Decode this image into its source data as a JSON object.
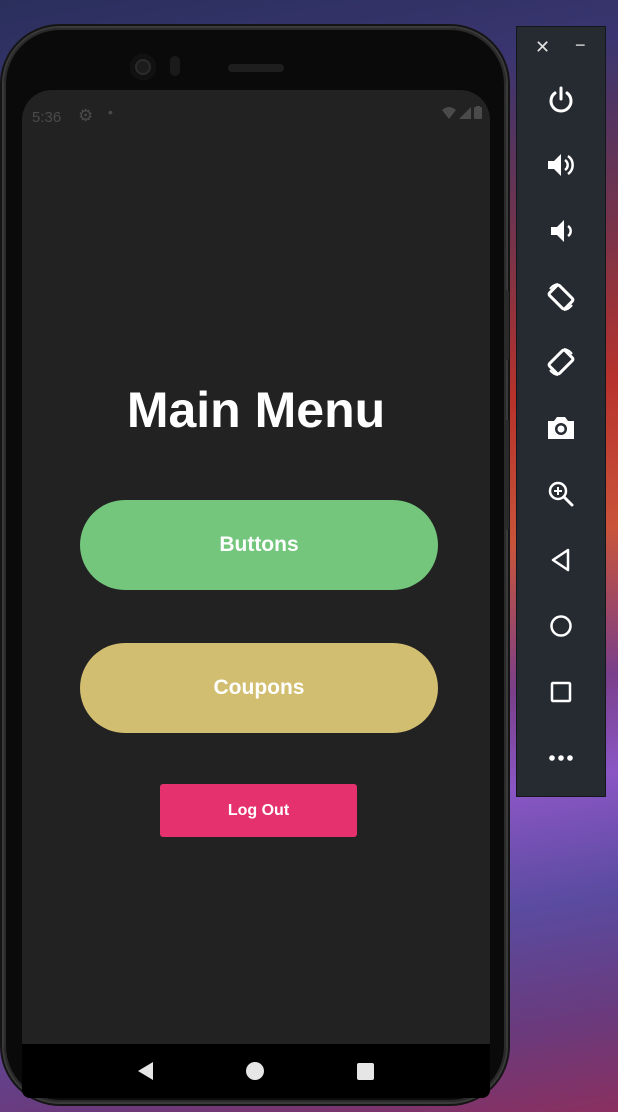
{
  "status_bar": {
    "time": "5:36"
  },
  "screen": {
    "title": "Main Menu",
    "buttons_label": "Buttons",
    "coupons_label": "Coupons",
    "logout_label": "Log Out"
  },
  "colors": {
    "background": "#222222",
    "buttons_green": "#73c67c",
    "coupons_gold": "#d2be70",
    "logout_pink": "#e5316e"
  },
  "emulator_toolbar": {
    "close_glyph": "✕",
    "minimize_glyph": "−",
    "items": [
      {
        "name": "power-icon"
      },
      {
        "name": "volume-up-icon"
      },
      {
        "name": "volume-down-icon"
      },
      {
        "name": "rotate-left-icon"
      },
      {
        "name": "rotate-right-icon"
      },
      {
        "name": "camera-icon"
      },
      {
        "name": "zoom-icon"
      },
      {
        "name": "back-icon"
      },
      {
        "name": "home-icon"
      },
      {
        "name": "overview-icon"
      },
      {
        "name": "more-icon"
      }
    ]
  },
  "nav_bar": {
    "icons": [
      "back-triangle-icon",
      "home-circle-icon",
      "recents-square-icon"
    ]
  }
}
